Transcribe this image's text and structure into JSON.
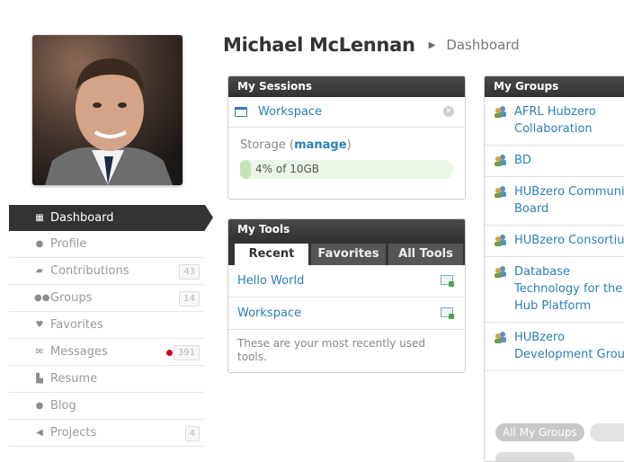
{
  "profile": {
    "name": "Michael McLennan",
    "section": "Dashboard"
  },
  "nav": {
    "items": [
      {
        "label": "Dashboard",
        "icon": "dashboard-icon",
        "active": true
      },
      {
        "label": "Profile",
        "icon": "user-icon"
      },
      {
        "label": "Contributions",
        "icon": "book-icon",
        "count": "43"
      },
      {
        "label": "Groups",
        "icon": "users-icon",
        "count": "14"
      },
      {
        "label": "Favorites",
        "icon": "heart-icon"
      },
      {
        "label": "Messages",
        "icon": "envelope-icon",
        "count": "391"
      },
      {
        "label": "Resume",
        "icon": "document-icon"
      },
      {
        "label": "Blog",
        "icon": "speech-bubble-icon"
      },
      {
        "label": "Projects",
        "icon": "paper-plane-icon",
        "count": "4"
      }
    ]
  },
  "sessions": {
    "title": "My Sessions",
    "items": [
      {
        "label": "Workspace"
      }
    ],
    "storage_label": "Storage (",
    "manage_label": "manage",
    "storage_close": ")",
    "storage_usage": "4% of 10GB",
    "storage_percent": 4
  },
  "tools": {
    "title": "My Tools",
    "tabs": [
      "Recent",
      "Favorites",
      "All Tools"
    ],
    "items": [
      {
        "label": "Hello World"
      },
      {
        "label": "Workspace"
      }
    ],
    "note": "These are your most recently used tools."
  },
  "groups": {
    "title": "My Groups",
    "items": [
      {
        "label": "AFRL Hubzero Collaboration"
      },
      {
        "label": "BD"
      },
      {
        "label": "HUBzero Community Board"
      },
      {
        "label": "HUBzero Consortium"
      },
      {
        "label": "Database Technology for the Hub Platform"
      },
      {
        "label": "HUBzero Development Group"
      }
    ],
    "all_label": "All My Groups"
  },
  "colors": {
    "accent": "#2b7fb8",
    "dark": "#333333",
    "alert": "#d0021b",
    "storage": "#c4e4b4"
  }
}
